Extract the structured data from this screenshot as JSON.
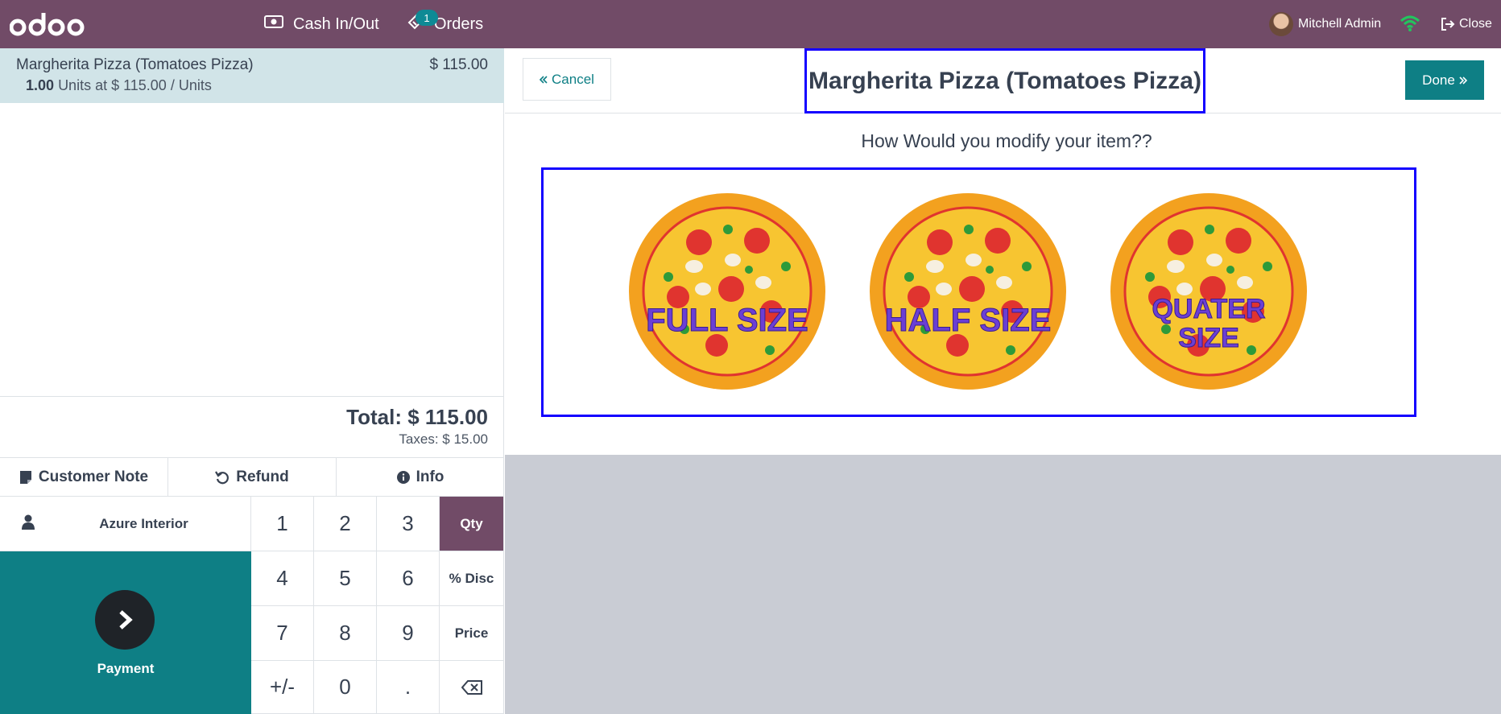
{
  "topbar": {
    "logo_text": "odoo",
    "cash_label": "Cash In/Out",
    "orders_label": "Orders",
    "orders_badge": "1",
    "user_name": "Mitchell Admin",
    "close_label": "Close"
  },
  "order": {
    "line_name": "Margherita Pizza (Tomatoes Pizza)",
    "line_price": "$ 115.00",
    "line_qty": "1.00",
    "line_detail": "Units at $ 115.00 / Units",
    "total": "Total: $ 115.00",
    "taxes": "Taxes: $ 15.00"
  },
  "controls": {
    "customer_note": "Customer Note",
    "refund": "Refund",
    "info": "Info"
  },
  "customer": "Azure Interior",
  "payment_label": "Payment",
  "numpad": {
    "k1": "1",
    "k2": "2",
    "k3": "3",
    "k4": "4",
    "k5": "5",
    "k6": "6",
    "k7": "7",
    "k8": "8",
    "k9": "9",
    "kpm": "+/-",
    "k0": "0",
    "kdot": ".",
    "qty": "Qty",
    "disc": "% Disc",
    "price": "Price"
  },
  "popup": {
    "cancel_label": "Cancel",
    "title": "Margherita Pizza (Tomatoes Pizza)",
    "done_label": "Done",
    "question": "How Would you modify your item??",
    "options": [
      "FULL SIZE",
      "HALF SIZE",
      "QUATER SIZE"
    ]
  },
  "colors": {
    "brand": "#714b67",
    "teal": "#0e7f85",
    "highlight": "#1400ff",
    "orderline_bg": "#d1e4e8"
  }
}
